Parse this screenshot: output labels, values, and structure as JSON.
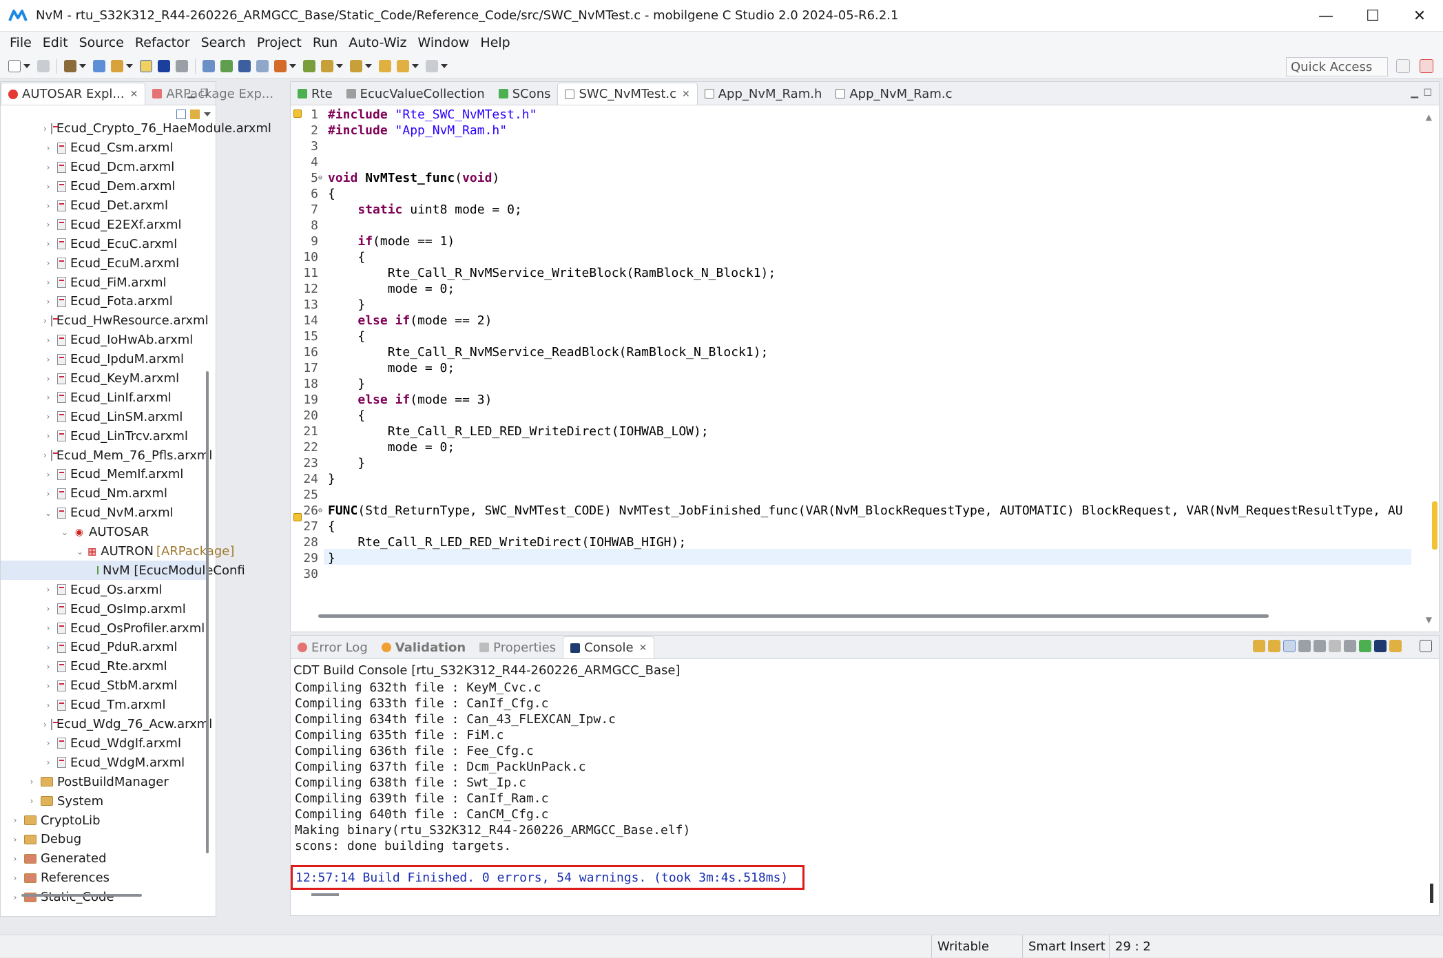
{
  "window": {
    "title": "NvM - rtu_S32K312_R44-260226_ARMGCC_Base/Static_Code/Reference_Code/src/SWC_NvMTest.c - mobilgene C Studio 2.0 2024-05-R6.2.1",
    "minimize": "—",
    "maximize": "☐",
    "close": "✕"
  },
  "menu": [
    "File",
    "Edit",
    "Source",
    "Refactor",
    "Search",
    "Project",
    "Run",
    "Auto-Wiz",
    "Window",
    "Help"
  ],
  "toolbar": {
    "quick_access": "Quick Access"
  },
  "left": {
    "tabs": [
      {
        "label": "AUTOSAR Expl...",
        "close": "✕"
      },
      {
        "label": "ARPackage Exp..."
      }
    ],
    "tree": [
      {
        "label": "Ecud_Crypto_76_HaeModule.arxml",
        "type": "file",
        "depth": 3
      },
      {
        "label": "Ecud_Csm.arxml",
        "type": "file",
        "depth": 3
      },
      {
        "label": "Ecud_Dcm.arxml",
        "type": "file",
        "depth": 3
      },
      {
        "label": "Ecud_Dem.arxml",
        "type": "file",
        "depth": 3
      },
      {
        "label": "Ecud_Det.arxml",
        "type": "file",
        "depth": 3
      },
      {
        "label": "Ecud_E2EXf.arxml",
        "type": "file",
        "depth": 3
      },
      {
        "label": "Ecud_EcuC.arxml",
        "type": "file",
        "depth": 3
      },
      {
        "label": "Ecud_EcuM.arxml",
        "type": "file",
        "depth": 3
      },
      {
        "label": "Ecud_FiM.arxml",
        "type": "file",
        "depth": 3
      },
      {
        "label": "Ecud_Fota.arxml",
        "type": "file",
        "depth": 3
      },
      {
        "label": "Ecud_HwResource.arxml",
        "type": "file",
        "depth": 3
      },
      {
        "label": "Ecud_IoHwAb.arxml",
        "type": "file",
        "depth": 3
      },
      {
        "label": "Ecud_IpduM.arxml",
        "type": "file",
        "depth": 3
      },
      {
        "label": "Ecud_KeyM.arxml",
        "type": "file",
        "depth": 3
      },
      {
        "label": "Ecud_LinIf.arxml",
        "type": "file",
        "depth": 3
      },
      {
        "label": "Ecud_LinSM.arxml",
        "type": "file",
        "depth": 3
      },
      {
        "label": "Ecud_LinTrcv.arxml",
        "type": "file",
        "depth": 3
      },
      {
        "label": "Ecud_Mem_76_Pfls.arxml",
        "type": "file",
        "depth": 3
      },
      {
        "label": "Ecud_MemIf.arxml",
        "type": "file",
        "depth": 3
      },
      {
        "label": "Ecud_Nm.arxml",
        "type": "file",
        "depth": 3
      },
      {
        "label": "Ecud_NvM.arxml",
        "type": "file",
        "depth": 3,
        "expanded": true
      },
      {
        "label": "AUTOSAR",
        "type": "pkg",
        "depth": 4,
        "expanded": true
      },
      {
        "label": "AUTRON",
        "tag": "[ARPackage]",
        "type": "pkg2",
        "depth": 5,
        "expanded": true
      },
      {
        "label": "NvM [EcucModuleConfi",
        "type": "conf",
        "depth": 6,
        "selected": true
      },
      {
        "label": "Ecud_Os.arxml",
        "type": "file",
        "depth": 3
      },
      {
        "label": "Ecud_OsImp.arxml",
        "type": "file",
        "depth": 3
      },
      {
        "label": "Ecud_OsProfiler.arxml",
        "type": "file",
        "depth": 3
      },
      {
        "label": "Ecud_PduR.arxml",
        "type": "file",
        "depth": 3
      },
      {
        "label": "Ecud_Rte.arxml",
        "type": "file",
        "depth": 3
      },
      {
        "label": "Ecud_StbM.arxml",
        "type": "file",
        "depth": 3
      },
      {
        "label": "Ecud_Tm.arxml",
        "type": "file",
        "depth": 3
      },
      {
        "label": "Ecud_Wdg_76_Acw.arxml",
        "type": "file",
        "depth": 3
      },
      {
        "label": "Ecud_WdgIf.arxml",
        "type": "file",
        "depth": 3
      },
      {
        "label": "Ecud_WdgM.arxml",
        "type": "file",
        "depth": 3
      },
      {
        "label": "PostBuildManager",
        "type": "folder",
        "depth": 2
      },
      {
        "label": "System",
        "type": "folder",
        "depth": 2
      },
      {
        "label": "CryptoLib",
        "type": "folder",
        "depth": 1
      },
      {
        "label": "Debug",
        "type": "folder",
        "depth": 1
      },
      {
        "label": "Generated",
        "type": "srcfolder",
        "depth": 1
      },
      {
        "label": "References",
        "type": "srcfolder",
        "depth": 1
      },
      {
        "label": "Static_Code",
        "type": "srcfolder",
        "depth": 1
      }
    ]
  },
  "editor": {
    "tabs": [
      {
        "label": "Rte"
      },
      {
        "label": "EcucValueCollection"
      },
      {
        "label": "SCons"
      },
      {
        "label": "SWC_NvMTest.c",
        "close": "✕",
        "active": true
      },
      {
        "label": "App_NvM_Ram.h"
      },
      {
        "label": "App_NvM_Ram.c"
      }
    ],
    "lines": [
      {
        "n": "1",
        "text": "#include \"Rte_SWC_NvMTest.h\""
      },
      {
        "n": "2",
        "text": "#include \"App_NvM_Ram.h\""
      },
      {
        "n": "3",
        "text": ""
      },
      {
        "n": "4",
        "text": ""
      },
      {
        "n": "5",
        "text": "void NvMTest_func(void)"
      },
      {
        "n": "6",
        "text": "{"
      },
      {
        "n": "7",
        "text": "    static uint8 mode = 0;"
      },
      {
        "n": "8",
        "text": ""
      },
      {
        "n": "9",
        "text": "    if(mode == 1)"
      },
      {
        "n": "10",
        "text": "    {"
      },
      {
        "n": "11",
        "text": "        Rte_Call_R_NvMService_WriteBlock(RamBlock_N_Block1);"
      },
      {
        "n": "12",
        "text": "        mode = 0;"
      },
      {
        "n": "13",
        "text": "    }"
      },
      {
        "n": "14",
        "text": "    else if(mode == 2)"
      },
      {
        "n": "15",
        "text": "    {"
      },
      {
        "n": "16",
        "text": "        Rte_Call_R_NvMService_ReadBlock(RamBlock_N_Block1);"
      },
      {
        "n": "17",
        "text": "        mode = 0;"
      },
      {
        "n": "18",
        "text": "    }"
      },
      {
        "n": "19",
        "text": "    else if(mode == 3)"
      },
      {
        "n": "20",
        "text": "    {"
      },
      {
        "n": "21",
        "text": "        Rte_Call_R_LED_RED_WriteDirect(IOHWAB_LOW);"
      },
      {
        "n": "22",
        "text": "        mode = 0;"
      },
      {
        "n": "23",
        "text": "    }"
      },
      {
        "n": "24",
        "text": "}"
      },
      {
        "n": "25",
        "text": ""
      },
      {
        "n": "26",
        "text": "FUNC(Std_ReturnType, SWC_NvMTest_CODE) NvMTest_JobFinished_func(VAR(NvM_BlockRequestType, AUTOMATIC) BlockRequest, VAR(NvM_RequestResultType, AU"
      },
      {
        "n": "27",
        "text": "{"
      },
      {
        "n": "28",
        "text": "    Rte_Call_R_LED_RED_WriteDirect(IOHWAB_HIGH);"
      },
      {
        "n": "29",
        "text": "}"
      },
      {
        "n": "30",
        "text": ""
      }
    ]
  },
  "console": {
    "tabs": [
      {
        "label": "Error Log"
      },
      {
        "label": "Validation"
      },
      {
        "label": "Properties"
      },
      {
        "label": "Console",
        "close": "✕",
        "active": true
      }
    ],
    "title": "CDT Build Console [rtu_S32K312_R44-260226_ARMGCC_Base]",
    "lines": [
      "Compiling 632th file : KeyM_Cvc.c",
      "Compiling 633th file : CanIf_Cfg.c",
      "Compiling 634th file : Can_43_FLEXCAN_Ipw.c",
      "Compiling 635th file : FiM.c",
      "Compiling 636th file : Fee_Cfg.c",
      "Compiling 637th file : Dcm_PackUnPack.c",
      "Compiling 638th file : Swt_Ip.c",
      "Compiling 639th file : CanIf_Ram.c",
      "Compiling 640th file : CanCM_Cfg.c",
      "Making binary(rtu_S32K312_R44-260226_ARMGCC_Base.elf)",
      "scons: done building targets."
    ],
    "build_status": "12:57:14 Build Finished. 0 errors, 54 warnings. (took 3m:4s.518ms)"
  },
  "status": {
    "writable": "Writable",
    "insert_mode": "Smart Insert",
    "position": "29 : 2"
  },
  "colors": {
    "keyword": "#7f0055",
    "string": "#2a00ff",
    "build_status_text": "#1a2fb0",
    "highlight_box": "#e01919"
  }
}
